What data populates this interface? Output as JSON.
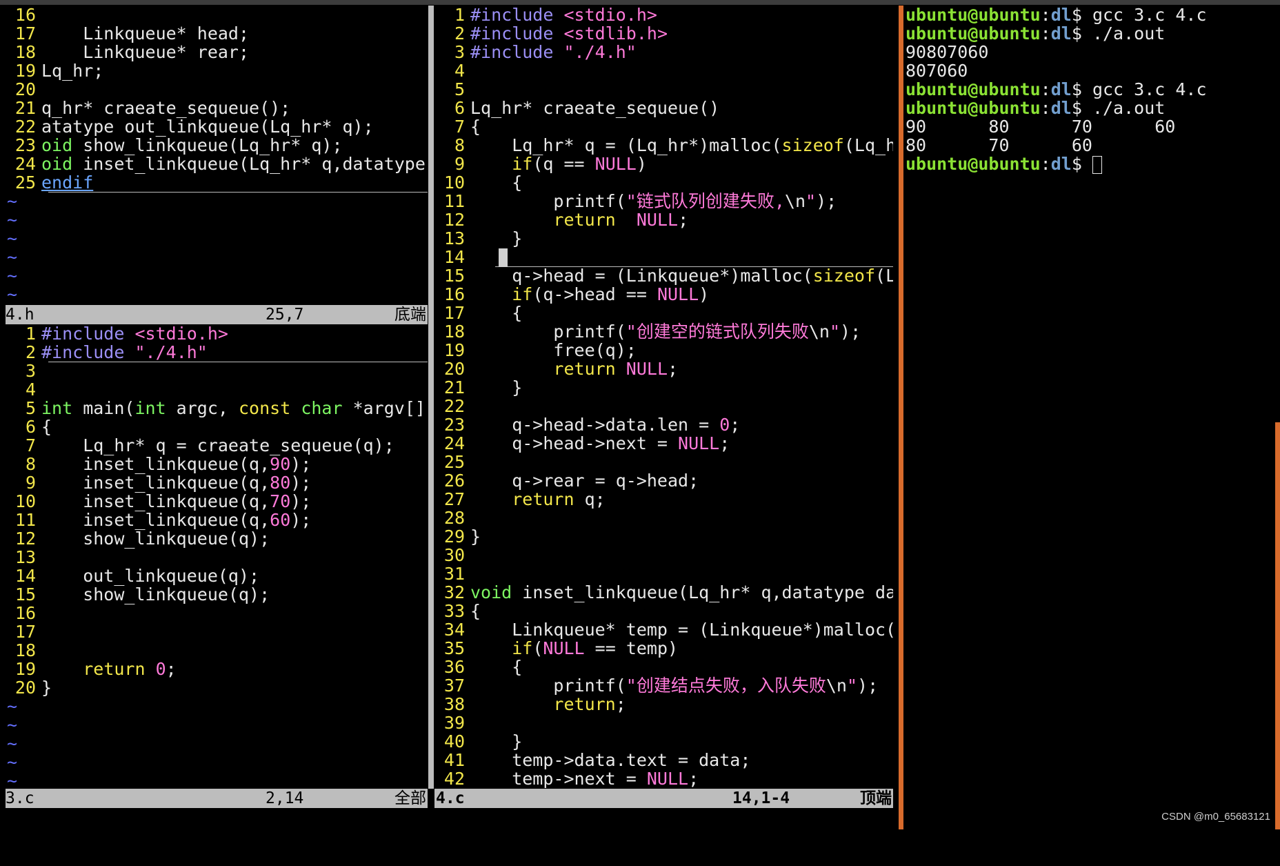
{
  "pane_4h": {
    "lines": [
      {
        "n": "16",
        "t": ""
      },
      {
        "n": "17",
        "t": "    Linkqueue* head;"
      },
      {
        "n": "18",
        "t": "    Linkqueue* rear;"
      },
      {
        "n": "19",
        "t": "Lq_hr;"
      },
      {
        "n": "20",
        "t": ""
      },
      {
        "n": "21",
        "t": "q_hr* craeate_sequeue();"
      },
      {
        "n": "22",
        "t": "atatype out_linkqueue(Lq_hr* q);"
      },
      {
        "n": "23",
        "t": "oid show_linkqueue(Lq_hr* q);"
      },
      {
        "n": "24",
        "t": "oid inset_linkqueue(Lq_hr* q,datatype data);"
      },
      {
        "n": "25",
        "t": "endif"
      }
    ],
    "status_file": "4.h",
    "status_pos": "25,7",
    "status_where": "底端"
  },
  "pane_3c": {
    "lines": [
      {
        "n": "1",
        "t": "#include <stdio.h>"
      },
      {
        "n": "2",
        "t": "#include \"./4.h\""
      },
      {
        "n": "3",
        "t": ""
      },
      {
        "n": "4",
        "t": ""
      },
      {
        "n": "5",
        "t": "int main(int argc, const char *argv[])"
      },
      {
        "n": "6",
        "t": "{"
      },
      {
        "n": "7",
        "t": "    Lq_hr* q = craeate_sequeue(q);"
      },
      {
        "n": "8",
        "t": "    inset_linkqueue(q,90);"
      },
      {
        "n": "9",
        "t": "    inset_linkqueue(q,80);"
      },
      {
        "n": "10",
        "t": "    inset_linkqueue(q,70);"
      },
      {
        "n": "11",
        "t": "    inset_linkqueue(q,60);"
      },
      {
        "n": "12",
        "t": "    show_linkqueue(q);"
      },
      {
        "n": "13",
        "t": ""
      },
      {
        "n": "14",
        "t": "    out_linkqueue(q);"
      },
      {
        "n": "15",
        "t": "    show_linkqueue(q);"
      },
      {
        "n": "16",
        "t": ""
      },
      {
        "n": "17",
        "t": ""
      },
      {
        "n": "18",
        "t": ""
      },
      {
        "n": "19",
        "t": "    return 0;"
      },
      {
        "n": "20",
        "t": "}"
      }
    ],
    "status_file": "3.c",
    "status_pos": "2,14",
    "status_where": "全部"
  },
  "pane_4c": {
    "lines": [
      {
        "n": "1",
        "t": "#include <stdio.h>"
      },
      {
        "n": "2",
        "t": "#include <stdlib.h>"
      },
      {
        "n": "3",
        "t": "#include \"./4.h\""
      },
      {
        "n": "4",
        "t": ""
      },
      {
        "n": "5",
        "t": ""
      },
      {
        "n": "6",
        "t": "Lq_hr* craeate_sequeue()"
      },
      {
        "n": "7",
        "t": "{"
      },
      {
        "n": "8",
        "t": "    Lq_hr* q = (Lq_hr*)malloc(sizeof(Lq_hr));"
      },
      {
        "n": "9",
        "t": "    if(q == NULL)"
      },
      {
        "n": "10",
        "t": "    {"
      },
      {
        "n": "11",
        "t": "        printf(\"链式队列创建失败,\\n\");"
      },
      {
        "n": "12",
        "t": "        return  NULL;"
      },
      {
        "n": "13",
        "t": "    }"
      },
      {
        "n": "14",
        "t": ""
      },
      {
        "n": "15",
        "t": "    q->head = (Linkqueue*)malloc(sizeof(Linkque"
      },
      {
        "n": "16",
        "t": "    if(q->head == NULL)"
      },
      {
        "n": "17",
        "t": "    {"
      },
      {
        "n": "18",
        "t": "        printf(\"创建空的链式队列失败\\n\");"
      },
      {
        "n": "19",
        "t": "        free(q);"
      },
      {
        "n": "20",
        "t": "        return NULL;"
      },
      {
        "n": "21",
        "t": "    }"
      },
      {
        "n": "22",
        "t": ""
      },
      {
        "n": "23",
        "t": "    q->head->data.len = 0;"
      },
      {
        "n": "24",
        "t": "    q->head->next = NULL;"
      },
      {
        "n": "25",
        "t": ""
      },
      {
        "n": "26",
        "t": "    q->rear = q->head;"
      },
      {
        "n": "27",
        "t": "    return q;"
      },
      {
        "n": "28",
        "t": ""
      },
      {
        "n": "29",
        "t": "}"
      },
      {
        "n": "30",
        "t": ""
      },
      {
        "n": "31",
        "t": ""
      },
      {
        "n": "32",
        "t": "void inset_linkqueue(Lq_hr* q,datatype data)"
      },
      {
        "n": "33",
        "t": "{"
      },
      {
        "n": "34",
        "t": "    Linkqueue* temp = (Linkqueue*)malloc(sizeof"
      },
      {
        "n": "35",
        "t": "    if(NULL == temp)"
      },
      {
        "n": "36",
        "t": "    {"
      },
      {
        "n": "37",
        "t": "        printf(\"创建结点失败，入队失败\\n\");"
      },
      {
        "n": "38",
        "t": "        return;"
      },
      {
        "n": "39",
        "t": ""
      },
      {
        "n": "40",
        "t": "    }"
      },
      {
        "n": "41",
        "t": "    temp->data.text = data;"
      },
      {
        "n": "42",
        "t": "    temp->next = NULL;"
      }
    ],
    "status_file": "4.c",
    "status_pos": "14,1-4",
    "status_where": "顶端"
  },
  "terminal": {
    "user_host": "ubuntu@ubuntu",
    "path": "dl",
    "lines": [
      {
        "type": "cmd",
        "cmd": " gcc 3.c 4.c"
      },
      {
        "type": "cmd",
        "cmd": " ./a.out"
      },
      {
        "type": "out",
        "text": "90807060"
      },
      {
        "type": "out",
        "text": "807060"
      },
      {
        "type": "cmd",
        "cmd": " gcc 3.c 4.c"
      },
      {
        "type": "cmd",
        "cmd": " ./a.out"
      },
      {
        "type": "out",
        "text": "90      80      70      60"
      },
      {
        "type": "out",
        "text": "80      70      60"
      },
      {
        "type": "prompt",
        "cmd": " "
      }
    ]
  },
  "watermark": "CSDN @m0_65683121",
  "colors": {
    "line_number": "#f2e64a",
    "keyword": "#f2e64a",
    "type": "#7df562",
    "string": "#ff7ad9",
    "preprocessor": "#9b8ff5",
    "tilde": "#6470ff",
    "status_bg": "#bdbdbd",
    "prompt_user": "#8be234",
    "prompt_path": "#729fcf",
    "divider_orange": "#d86b2c"
  }
}
